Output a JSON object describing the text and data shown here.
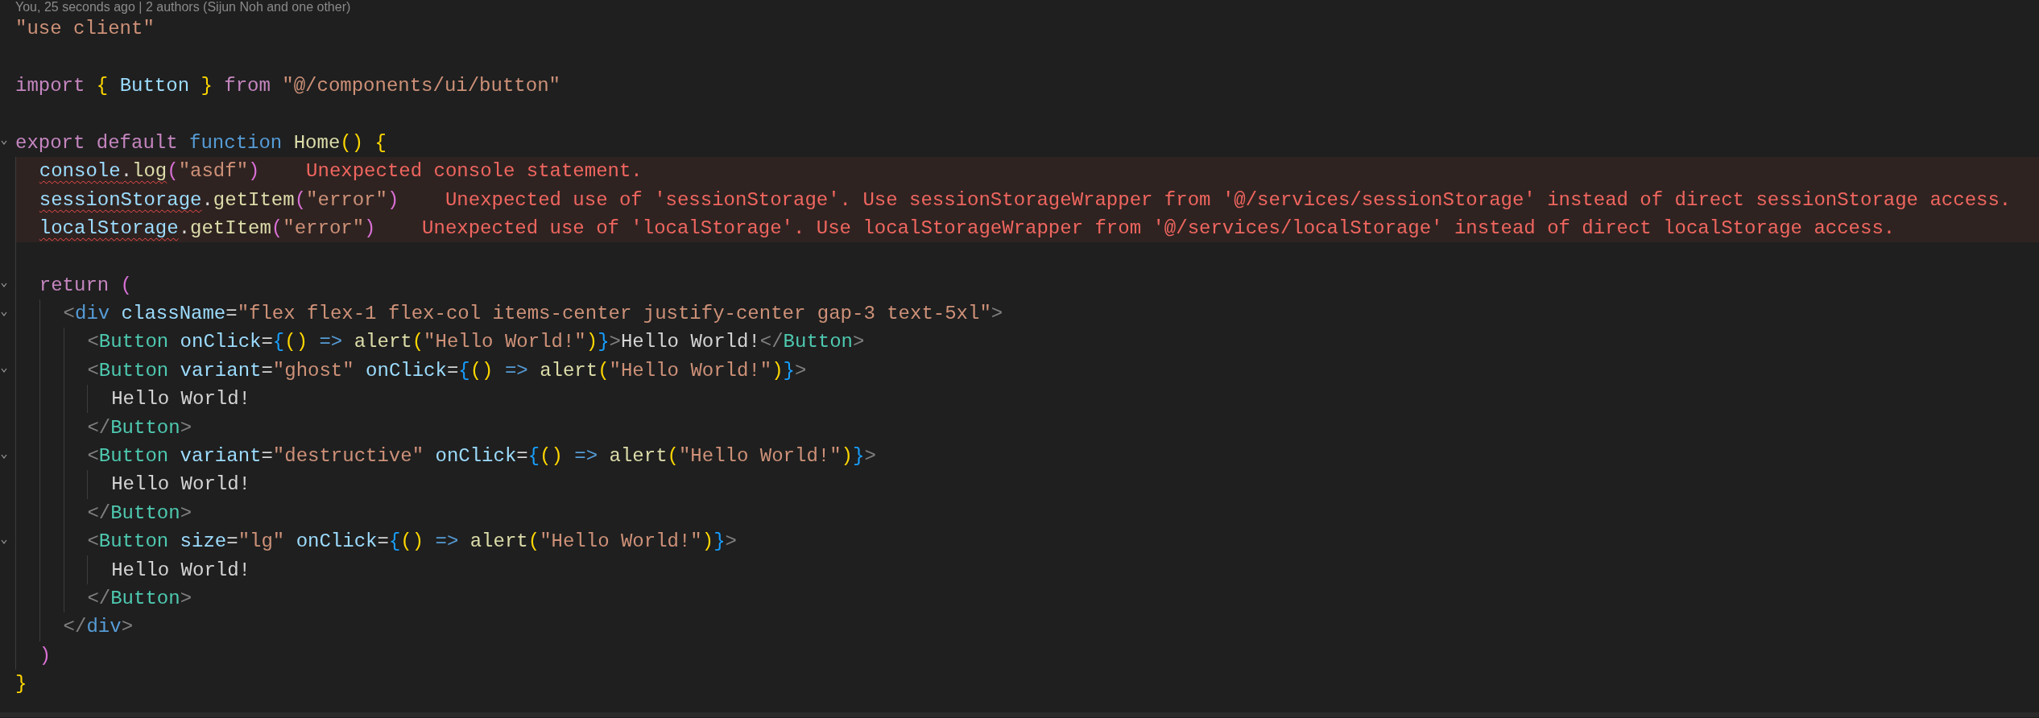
{
  "blame": "You, 25 seconds ago | 2 authors (Sijun Noh and one other)",
  "lines": [
    {
      "kind": "code",
      "tokens": [
        {
          "kind": "str",
          "text": "\"use client\""
        }
      ]
    },
    {
      "kind": "blank"
    },
    {
      "kind": "code",
      "tokens": [
        {
          "kind": "kw",
          "text": "import"
        },
        {
          "kind": "b1",
          "text": " {"
        },
        {
          "kind": "var",
          "text": " Button "
        },
        {
          "kind": "b1",
          "text": "}"
        },
        {
          "kind": "kw",
          "text": " from"
        },
        {
          "kind": "str",
          "text": " \"@/components/ui/button\""
        }
      ]
    },
    {
      "kind": "blank"
    },
    {
      "kind": "code",
      "tokens": [
        {
          "kind": "kw",
          "text": "export default"
        },
        {
          "kind": "storage",
          "text": " function"
        },
        {
          "kind": "fn",
          "text": " Home"
        },
        {
          "kind": "b1",
          "text": "()"
        },
        {
          "kind": "b1",
          "text": " {"
        }
      ],
      "children": [
        {
          "kind": "code",
          "diagnostic": "Unexpected console statement.",
          "tokens": [
            {
              "kind": "var",
              "text": "console",
              "squiggle": true
            },
            {
              "kind": "punct",
              "text": ".",
              "squiggle": true
            },
            {
              "kind": "fn",
              "text": "log",
              "squiggle": true
            },
            {
              "kind": "b2",
              "text": "(",
              "squiggle": false
            },
            {
              "kind": "str",
              "text": "\"asdf\"",
              "squiggle": false
            },
            {
              "kind": "b2",
              "text": ")",
              "squiggle": false
            }
          ]
        },
        {
          "kind": "code",
          "diagnostic": "Unexpected use of 'sessionStorage'. Use sessionStorageWrapper from '@/services/sessionStorage' instead of direct sessionStorage access.",
          "tokens": [
            {
              "kind": "var",
              "text": "sessionStorage",
              "squiggle": true
            },
            {
              "kind": "punct",
              "text": ".",
              "squiggle": false
            },
            {
              "kind": "fn",
              "text": "getItem",
              "squiggle": false
            },
            {
              "kind": "b2",
              "text": "(",
              "squiggle": false
            },
            {
              "kind": "str",
              "text": "\"error\"",
              "squiggle": false
            },
            {
              "kind": "b2",
              "text": ")",
              "squiggle": false
            }
          ]
        },
        {
          "kind": "code",
          "diagnostic": "Unexpected use of 'localStorage'. Use localStorageWrapper from '@/services/localStorage' instead of direct localStorage access.",
          "tokens": [
            {
              "kind": "var",
              "text": "localStorage",
              "squiggle": true
            },
            {
              "kind": "punct",
              "text": ".",
              "squiggle": false
            },
            {
              "kind": "fn",
              "text": "getItem",
              "squiggle": false
            },
            {
              "kind": "b2",
              "text": "(",
              "squiggle": false
            },
            {
              "kind": "str",
              "text": "\"error\"",
              "squiggle": false
            },
            {
              "kind": "b2",
              "text": ")",
              "squiggle": false
            }
          ]
        },
        {
          "kind": "blank"
        },
        {
          "kind": "code",
          "tokens": [
            {
              "kind": "kw",
              "text": "return"
            },
            {
              "kind": "b2",
              "text": " ("
            }
          ],
          "children": [
            {
              "kind": "code",
              "tokens": [
                {
                  "kind": "tag",
                  "text": "<"
                },
                {
                  "kind": "storage",
                  "text": "div"
                },
                {
                  "kind": "var",
                  "text": " className"
                },
                {
                  "kind": "punct",
                  "text": "="
                },
                {
                  "kind": "str",
                  "text": "\"flex flex-1 flex-col items-center justify-center gap-3 text-5xl\""
                },
                {
                  "kind": "tag",
                  "text": ">"
                }
              ],
              "children": [
                {
                  "kind": "code",
                  "tokens": [
                    {
                      "kind": "tag",
                      "text": "<"
                    },
                    {
                      "kind": "comp",
                      "text": "Button"
                    },
                    {
                      "kind": "var",
                      "text": " onClick"
                    },
                    {
                      "kind": "punct",
                      "text": "="
                    },
                    {
                      "kind": "b3",
                      "text": "{"
                    },
                    {
                      "kind": "b1",
                      "text": "()"
                    },
                    {
                      "kind": "op",
                      "text": " =>"
                    },
                    {
                      "kind": "fn",
                      "text": " alert"
                    },
                    {
                      "kind": "b1",
                      "text": "("
                    },
                    {
                      "kind": "str",
                      "text": "\"Hello World!\""
                    },
                    {
                      "kind": "b1",
                      "text": ")"
                    },
                    {
                      "kind": "b3",
                      "text": "}"
                    },
                    {
                      "kind": "tag",
                      "text": ">"
                    },
                    {
                      "kind": "punct",
                      "text": "Hello World!"
                    },
                    {
                      "kind": "tag",
                      "text": "</"
                    },
                    {
                      "kind": "comp",
                      "text": "Button"
                    },
                    {
                      "kind": "tag",
                      "text": ">"
                    }
                  ]
                },
                {
                  "kind": "code",
                  "tokens": [
                    {
                      "kind": "tag",
                      "text": "<"
                    },
                    {
                      "kind": "comp",
                      "text": "Button"
                    },
                    {
                      "kind": "var",
                      "text": " variant"
                    },
                    {
                      "kind": "punct",
                      "text": "="
                    },
                    {
                      "kind": "str",
                      "text": "\"ghost\""
                    },
                    {
                      "kind": "var",
                      "text": " onClick"
                    },
                    {
                      "kind": "punct",
                      "text": "="
                    },
                    {
                      "kind": "b3",
                      "text": "{"
                    },
                    {
                      "kind": "b1",
                      "text": "()"
                    },
                    {
                      "kind": "op",
                      "text": " =>"
                    },
                    {
                      "kind": "fn",
                      "text": " alert"
                    },
                    {
                      "kind": "b1",
                      "text": "("
                    },
                    {
                      "kind": "str",
                      "text": "\"Hello World!\""
                    },
                    {
                      "kind": "b1",
                      "text": ")"
                    },
                    {
                      "kind": "b3",
                      "text": "}"
                    },
                    {
                      "kind": "tag",
                      "text": ">"
                    }
                  ],
                  "children": [
                    {
                      "kind": "code",
                      "tokens": [
                        {
                          "kind": "punct",
                          "text": "Hello World!"
                        }
                      ]
                    }
                  ]
                },
                {
                  "kind": "code",
                  "tokens": [
                    {
                      "kind": "tag",
                      "text": "</"
                    },
                    {
                      "kind": "comp",
                      "text": "Button"
                    },
                    {
                      "kind": "tag",
                      "text": ">"
                    }
                  ]
                },
                {
                  "kind": "code",
                  "tokens": [
                    {
                      "kind": "tag",
                      "text": "<"
                    },
                    {
                      "kind": "comp",
                      "text": "Button"
                    },
                    {
                      "kind": "var",
                      "text": " variant"
                    },
                    {
                      "kind": "punct",
                      "text": "="
                    },
                    {
                      "kind": "str",
                      "text": "\"destructive\""
                    },
                    {
                      "kind": "var",
                      "text": " onClick"
                    },
                    {
                      "kind": "punct",
                      "text": "="
                    },
                    {
                      "kind": "b3",
                      "text": "{"
                    },
                    {
                      "kind": "b1",
                      "text": "()"
                    },
                    {
                      "kind": "op",
                      "text": " =>"
                    },
                    {
                      "kind": "fn",
                      "text": " alert"
                    },
                    {
                      "kind": "b1",
                      "text": "("
                    },
                    {
                      "kind": "str",
                      "text": "\"Hello World!\""
                    },
                    {
                      "kind": "b1",
                      "text": ")"
                    },
                    {
                      "kind": "b3",
                      "text": "}"
                    },
                    {
                      "kind": "tag",
                      "text": ">"
                    }
                  ],
                  "children": [
                    {
                      "kind": "code",
                      "tokens": [
                        {
                          "kind": "punct",
                          "text": "Hello World!"
                        }
                      ]
                    }
                  ]
                },
                {
                  "kind": "code",
                  "tokens": [
                    {
                      "kind": "tag",
                      "text": "</"
                    },
                    {
                      "kind": "comp",
                      "text": "Button"
                    },
                    {
                      "kind": "tag",
                      "text": ">"
                    }
                  ]
                },
                {
                  "kind": "code",
                  "tokens": [
                    {
                      "kind": "tag",
                      "text": "<"
                    },
                    {
                      "kind": "comp",
                      "text": "Button"
                    },
                    {
                      "kind": "var",
                      "text": " size"
                    },
                    {
                      "kind": "punct",
                      "text": "="
                    },
                    {
                      "kind": "str",
                      "text": "\"lg\""
                    },
                    {
                      "kind": "var",
                      "text": " onClick"
                    },
                    {
                      "kind": "punct",
                      "text": "="
                    },
                    {
                      "kind": "b3",
                      "text": "{"
                    },
                    {
                      "kind": "b1",
                      "text": "()"
                    },
                    {
                      "kind": "op",
                      "text": " =>"
                    },
                    {
                      "kind": "fn",
                      "text": " alert"
                    },
                    {
                      "kind": "b1",
                      "text": "("
                    },
                    {
                      "kind": "str",
                      "text": "\"Hello World!\""
                    },
                    {
                      "kind": "b1",
                      "text": ")"
                    },
                    {
                      "kind": "b3",
                      "text": "}"
                    },
                    {
                      "kind": "tag",
                      "text": ">"
                    }
                  ],
                  "children": [
                    {
                      "kind": "code",
                      "tokens": [
                        {
                          "kind": "punct",
                          "text": "Hello World!"
                        }
                      ]
                    }
                  ]
                },
                {
                  "kind": "code",
                  "tokens": [
                    {
                      "kind": "tag",
                      "text": "</"
                    },
                    {
                      "kind": "comp",
                      "text": "Button"
                    },
                    {
                      "kind": "tag",
                      "text": ">"
                    }
                  ]
                }
              ]
            },
            {
              "kind": "code",
              "tokens": [
                {
                  "kind": "tag",
                  "text": "</"
                },
                {
                  "kind": "storage",
                  "text": "div"
                },
                {
                  "kind": "tag",
                  "text": ">"
                }
              ]
            }
          ]
        },
        {
          "kind": "code",
          "tokens": [
            {
              "kind": "b2",
              "text": ")"
            }
          ]
        }
      ]
    },
    {
      "kind": "code",
      "tokens": [
        {
          "kind": "b1",
          "text": "}"
        }
      ]
    }
  ]
}
